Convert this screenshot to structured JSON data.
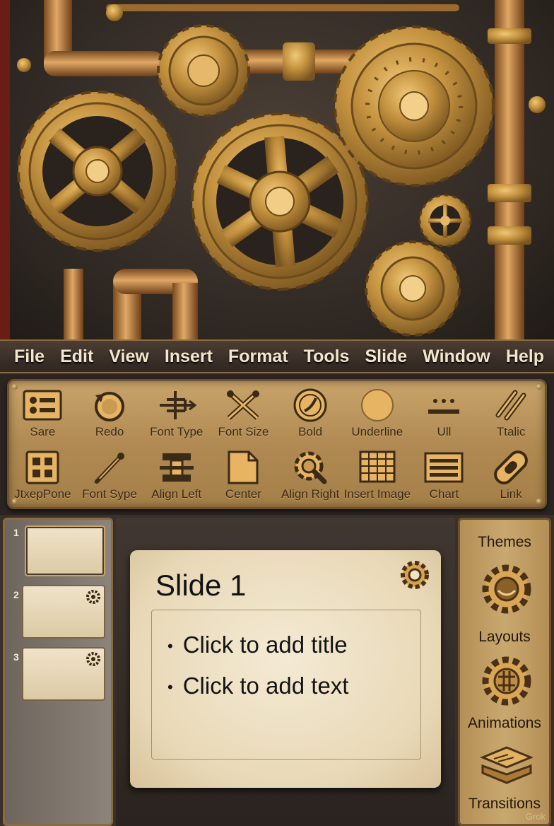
{
  "menubar": {
    "items": [
      "File",
      "Edit",
      "View",
      "Insert",
      "Format",
      "Tools",
      "Slide",
      "Window",
      "Help"
    ]
  },
  "toolbar": {
    "row1": [
      {
        "label": "Sare",
        "icon": "save-icon"
      },
      {
        "label": "Redo",
        "icon": "redo-icon"
      },
      {
        "label": "Font Type",
        "icon": "font-type-icon"
      },
      {
        "label": "Font Size",
        "icon": "font-size-icon"
      },
      {
        "label": "Bold",
        "icon": "bold-icon"
      },
      {
        "label": "Underline",
        "icon": "underline-icon"
      },
      {
        "label": "Ull",
        "icon": "ull-icon"
      },
      {
        "label": "Ttalic",
        "icon": "italic-icon"
      }
    ],
    "row2": [
      {
        "label": "JtxepPone",
        "icon": "grid-icon"
      },
      {
        "label": "Font Sype",
        "icon": "pen-icon"
      },
      {
        "label": "Align Left",
        "icon": "align-left-icon"
      },
      {
        "label": "Center",
        "icon": "center-icon"
      },
      {
        "label": "Align Right",
        "icon": "align-right-icon"
      },
      {
        "label": "Insert Image",
        "icon": "insert-image-icon"
      },
      {
        "label": "Chart",
        "icon": "chart-icon"
      },
      {
        "label": "Link",
        "icon": "link-icon"
      }
    ]
  },
  "slides_panel": {
    "thumbnails": [
      {
        "number": "1"
      },
      {
        "number": "2"
      },
      {
        "number": "3"
      }
    ]
  },
  "slide": {
    "title": "Slide 1",
    "bullets": [
      "Click to add title",
      "Click to add text"
    ]
  },
  "right_panel": {
    "items": [
      "Themes",
      "Layouts",
      "Animations",
      "Transitions"
    ]
  },
  "watermark": "Grok",
  "colors": {
    "brass": "#c9a36a",
    "dark_bronze": "#6d5130",
    "parchment": "#f0e4c8",
    "menu_text": "#f3e6cc"
  }
}
